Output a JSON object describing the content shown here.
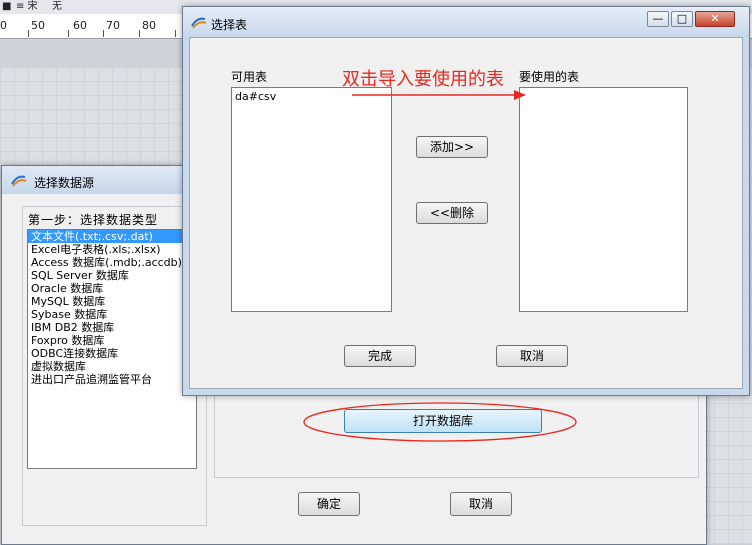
{
  "background_app": {
    "toolbar_items": [
      "■",
      "≡ 宋",
      "无"
    ],
    "ruler_numbers": [
      "0",
      "50",
      "60",
      "70",
      "80"
    ]
  },
  "datasource_dialog": {
    "title": "选择数据源",
    "step_label": "第一步：选择数据类型",
    "types": [
      "文本文件(.txt;.csv;.dat)",
      "Excel电子表格(.xls;.xlsx)",
      "Access 数据库(.mdb;.accdb)",
      "SQL Server 数据库",
      "Oracle 数据库",
      "MySQL 数据库",
      "Sybase 数据库",
      "IBM DB2 数据库",
      "Foxpro 数据库",
      "ODBC连接数据库",
      "虚拟数据库",
      "进出口产品追溯监管平台"
    ],
    "selected_index": 0,
    "open_db_button": "打开数据库",
    "ok_button": "确定",
    "cancel_button": "取消"
  },
  "select_table_dialog": {
    "title": "选择表",
    "available_label": "可用表",
    "available_tables": [
      "da#csv"
    ],
    "used_label": "要使用的表",
    "used_tables": [],
    "add_button": "添加>>",
    "remove_button": "<<删除",
    "finish_button": "完成",
    "cancel_button": "取消",
    "window_controls": {
      "minimize": "—",
      "maximize": "□",
      "close": "✕"
    }
  },
  "annotation": {
    "text": "双击导入要使用的表",
    "color": "#e8281e"
  }
}
